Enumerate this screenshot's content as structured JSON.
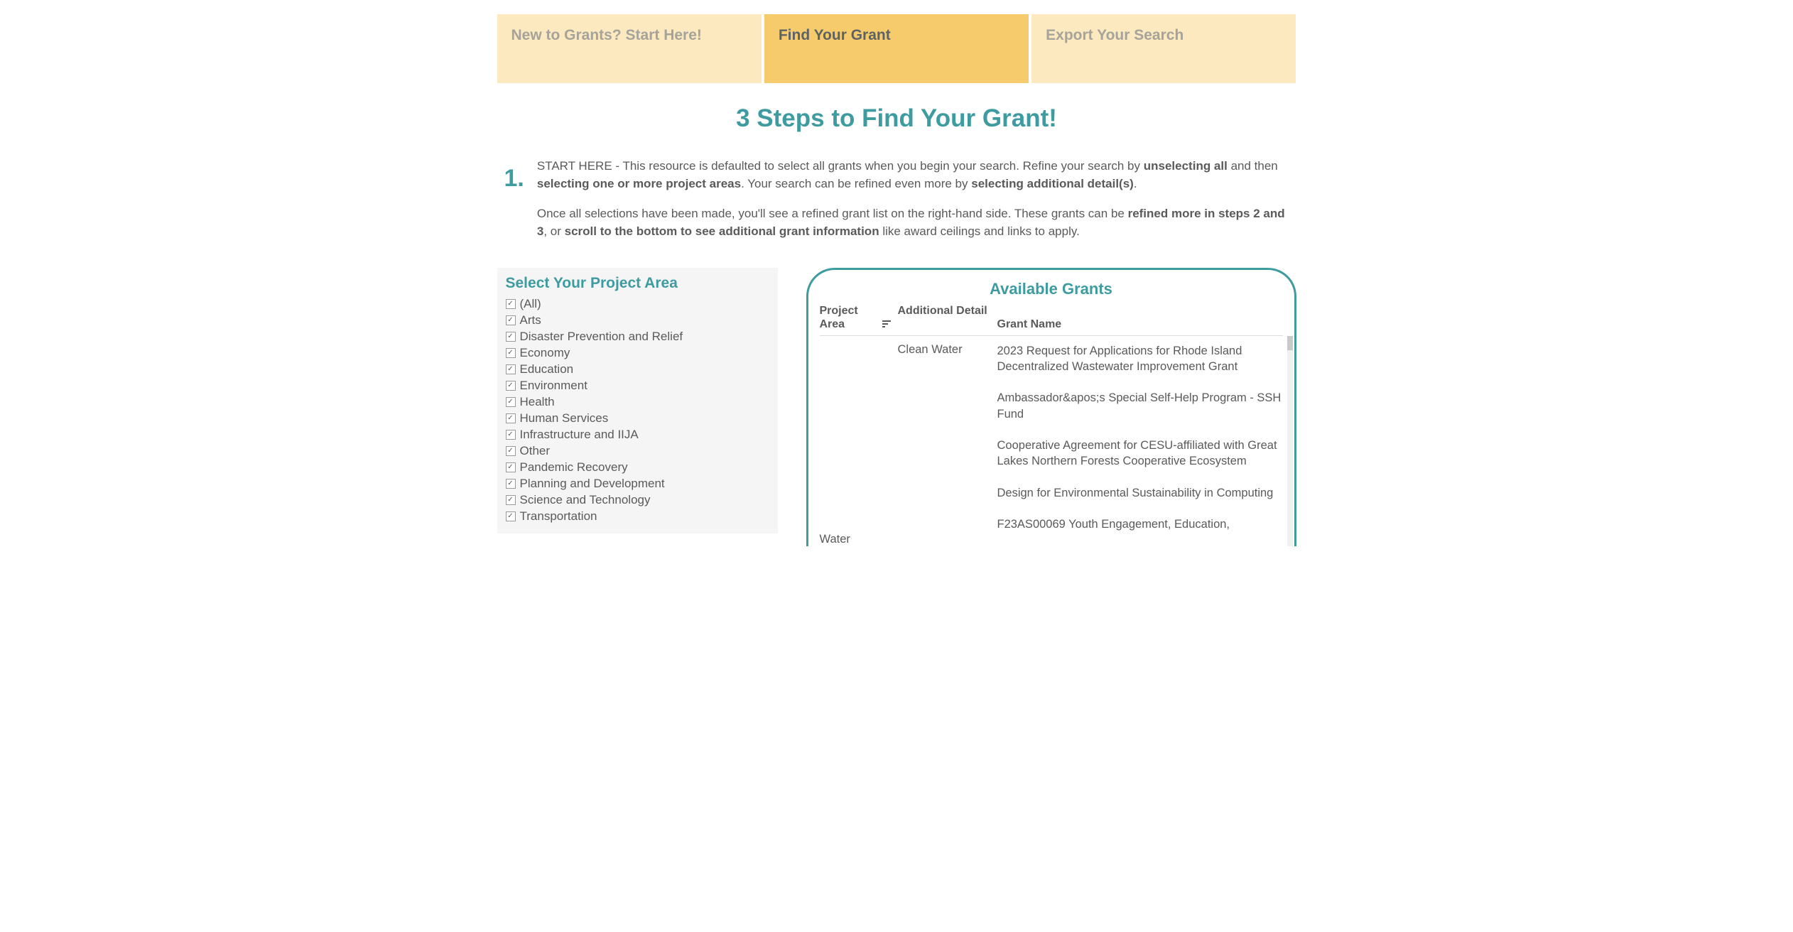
{
  "tabs": [
    {
      "label": "New to Grants? Start Here!",
      "active": false
    },
    {
      "label": "Find Your Grant",
      "active": true
    },
    {
      "label": "Export Your Search",
      "active": false
    }
  ],
  "pageTitle": "3 Steps to Find Your Grant!",
  "step1": {
    "num": "1.",
    "p1_seg1": "START HERE - This resource is defaulted to select all grants when you begin your search. Refine your search by ",
    "p1_b1": "unselecting all",
    "p1_seg2": " and then ",
    "p1_b2": "selecting one or more project areas",
    "p1_seg3": ". Your search can be refined even more by ",
    "p1_b3": "selecting additional detail(s)",
    "p1_seg4": ".",
    "p2_seg1": "Once all selections have been made, you'll see a refined grant list on the right-hand side. These grants can be ",
    "p2_b1": "refined more in steps 2 and 3",
    "p2_seg2": ", or ",
    "p2_b2": "scroll to the bottom to see additional grant information",
    "p2_seg3": " like award ceilings and links to apply."
  },
  "filter": {
    "title": "Select Your Project Area",
    "items": [
      "(All)",
      "Arts",
      "Disaster Prevention and Relief",
      "Economy",
      "Education",
      "Environment",
      "Health",
      "Human Services",
      "Infrastructure and IIJA",
      "Other",
      "Pandemic Recovery",
      "Planning and Development",
      "Science and Technology",
      "Transportation"
    ]
  },
  "grants": {
    "title": "Available Grants",
    "headers": {
      "area": "Project Area",
      "detail": "Additional Detail",
      "name": "Grant Name"
    },
    "row": {
      "area": "Water",
      "detail": "Clean Water"
    },
    "names": [
      "2023 Request for Applications for Rhode Island Decentralized Wastewater Improvement Grant",
      "Ambassador&apos;s Special Self-Help Program - SSH Fund",
      "Cooperative Agreement for CESU-affiliated with Great Lakes Northern Forests Cooperative Ecosystem",
      "Design for Environmental Sustainability in Computing",
      "F23AS00069 Youth Engagement, Education,"
    ]
  }
}
